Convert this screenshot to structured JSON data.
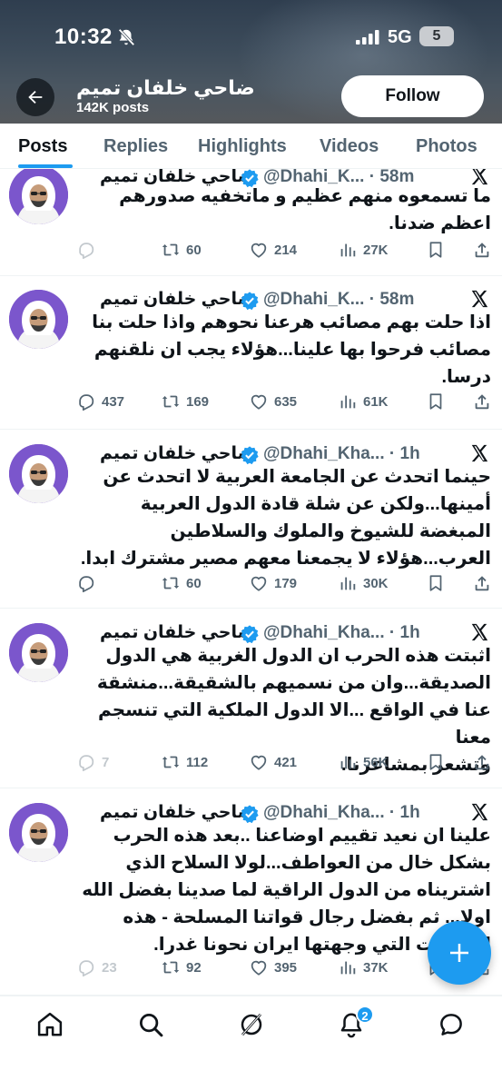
{
  "status_bar": {
    "time": "10:32",
    "network": "5G",
    "battery": "5"
  },
  "profile": {
    "name": "ضاحي خلفان تميم",
    "posts_count": "142K posts",
    "follow_label": "Follow"
  },
  "tabs": [
    {
      "label": "Posts",
      "active": true
    },
    {
      "label": "Replies",
      "active": false
    },
    {
      "label": "Highlights",
      "active": false
    },
    {
      "label": "Videos",
      "active": false
    },
    {
      "label": "Photos",
      "active": false
    }
  ],
  "posts": [
    {
      "author": "ضاحي خلفان تميم",
      "handle": "@Dhahi_K...",
      "time": "58m",
      "lines": [
        "ما تسمعوه منهم عظيم و ماتخفيه صدورهم",
        "اعظم ضدنا."
      ],
      "replies": "",
      "reposts": "60",
      "likes": "214",
      "views": "27K"
    },
    {
      "author": "ضاحي خلفان تميم",
      "handle": "@Dhahi_K...",
      "time": "58m",
      "lines": [
        "اذا حلت بهم مصائب هرعنا نحوهم واذا حلت بنا",
        "مصائب فرحوا بها علينا...هؤلاء يجب ان نلقنهم",
        "درسا."
      ],
      "replies": "437",
      "reposts": "169",
      "likes": "635",
      "views": "61K"
    },
    {
      "author": "ضاحي خلفان تميم",
      "handle": "@Dhahi_Kha...",
      "time": "1h",
      "lines": [
        "حينما اتحدث عن الجامعة العربية  لا اتحدث عن",
        "أمينها...ولكن عن شلة قادة الدول العربية",
        "المبغضة للشيوخ والملوك والسلاطين",
        "العرب...هؤلاء لا يجمعنا معهم مصير مشترك ابدا."
      ],
      "replies": "",
      "reposts": "60",
      "likes": "179",
      "views": "30K"
    },
    {
      "author": "ضاحي خلفان تميم",
      "handle": "@Dhahi_Kha...",
      "time": "1h",
      "lines": [
        "اثبتت هذه الحرب ان الدول الغربية هي الدول",
        "الصديقة...وان من نسميهم بالشقيقة...منشقة",
        "عنا في الواقع ...الا الدول الملكية التي تنسجم معنا",
        "وتشعر بمشاعرنا."
      ],
      "replies": "7",
      "reposts": "112",
      "likes": "421",
      "views": "56K"
    },
    {
      "author": "ضاحي خلفان تميم",
      "handle": "@Dhahi_Kha...",
      "time": "1h",
      "lines": [
        "علينا ان نعيد تقييم اوضاعنا ..بعد هذه الحرب",
        "بشكل خال من العواطف...لولا السلاح الذي",
        "اشتريناه من الدول الراقية لما صدينا بفضل الله",
        "اولا... ثم بفضل رجال قواتنا المسلحة - هذه",
        "الهجمات التي وجهتها ايران نحونا غدرا."
      ],
      "replies": "23",
      "reposts": "92",
      "likes": "395",
      "views": "37K"
    }
  ],
  "bottom_nav": {
    "notifications_badge": "2"
  },
  "colors": {
    "accent": "#1d9bf0",
    "verified": "#1d9bf0",
    "text": "#0f1419",
    "muted": "#536471"
  }
}
